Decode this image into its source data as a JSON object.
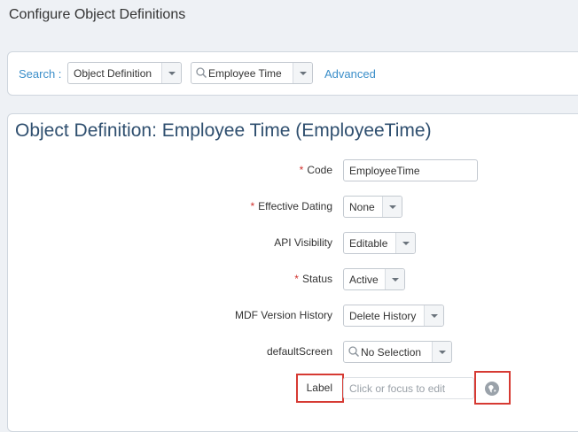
{
  "page": {
    "title": "Configure Object Definitions"
  },
  "search": {
    "label": "Search :",
    "type_selected": "Object Definition",
    "query_value": "Employee Time",
    "advanced_label": "Advanced"
  },
  "object": {
    "title": "Object Definition: Employee Time (EmployeeTime)",
    "fields": {
      "code": {
        "label": "Code",
        "required": "*",
        "value": "EmployeeTime"
      },
      "effective_dating": {
        "label": "Effective Dating",
        "required": "*",
        "value": "None"
      },
      "api_visibility": {
        "label": "API Visibility",
        "value": "Editable"
      },
      "status": {
        "label": "Status",
        "required": "*",
        "value": "Active"
      },
      "mdf_version_history": {
        "label": "MDF Version History",
        "value": "Delete History"
      },
      "default_screen": {
        "label": "defaultScreen",
        "value": "No Selection"
      },
      "label": {
        "label": "Label",
        "placeholder": "Click or focus to edit"
      }
    }
  },
  "colors": {
    "accent": "#3a8ec9",
    "title": "#2f4f6f",
    "required": "#d0312d",
    "highlight": "#d63a33"
  },
  "icons": [
    "magnifier-icon",
    "chevron-down-icon",
    "globe-icon"
  ]
}
